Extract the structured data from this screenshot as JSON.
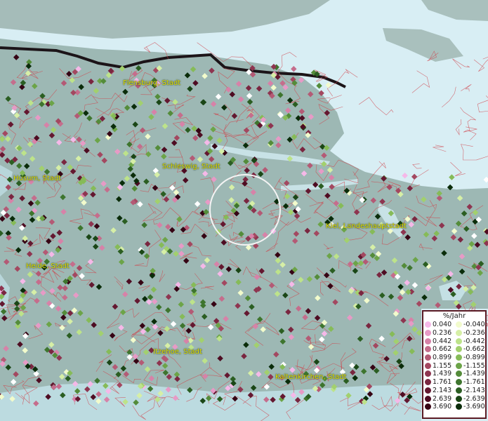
{
  "cities": [
    {
      "name": "Flensburg, Stadt"
    },
    {
      "name": "Schleswig, Stadt"
    },
    {
      "name": "Husum, Stadt"
    },
    {
      "name": "Kiel, Landeshauptstadt"
    },
    {
      "name": "Heide, Stadt"
    },
    {
      "name": "Itzehoe, Stadt"
    },
    {
      "name": "Kaltenkirchen, Stadt"
    }
  ],
  "legend": {
    "title": "%/Jahr",
    "positive": [
      {
        "label": "0.040",
        "color": "#f5b8e8"
      },
      {
        "label": "0.236",
        "color": "#e79ac6"
      },
      {
        "label": "0.442",
        "color": "#d782a8"
      },
      {
        "label": "0.662",
        "color": "#c56d8c"
      },
      {
        "label": "0.899",
        "color": "#b45a75"
      },
      {
        "label": "1.155",
        "color": "#a34860"
      },
      {
        "label": "1.439",
        "color": "#8e3550"
      },
      {
        "label": "1.761",
        "color": "#7a2640"
      },
      {
        "label": "2.143",
        "color": "#641830"
      },
      {
        "label": "2.639",
        "color": "#4e0c22"
      },
      {
        "label": "3.690",
        "color": "#360414"
      }
    ],
    "negative": [
      {
        "label": "-0.040",
        "color": "#f2fbcc"
      },
      {
        "label": "-0.236",
        "color": "#d6efa6"
      },
      {
        "label": "-0.442",
        "color": "#bde38a"
      },
      {
        "label": "-0.662",
        "color": "#a2d06e"
      },
      {
        "label": "-0.899",
        "color": "#86bb58"
      },
      {
        "label": "-1.155",
        "color": "#6ca448"
      },
      {
        "label": "-1.439",
        "color": "#548c3a"
      },
      {
        "label": "-1.761",
        "color": "#3e752e"
      },
      {
        "label": "-2.143",
        "color": "#2b5e22"
      },
      {
        "label": "-2.639",
        "color": "#1a4616"
      },
      {
        "label": "-3.690",
        "color": "#0a2c0a"
      }
    ]
  },
  "colors": {
    "sea": "#d8eef4",
    "land": "#9fb9b5",
    "boundary": "#d04048",
    "border": "#1c1418",
    "label": "#e3e000"
  }
}
